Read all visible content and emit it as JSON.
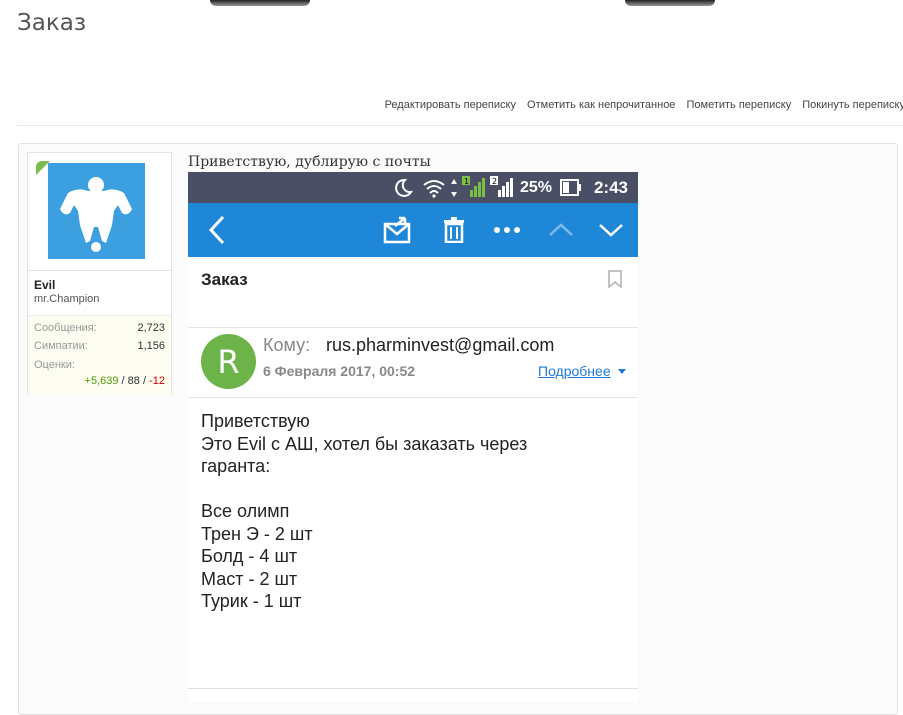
{
  "page": {
    "title": "Заказ"
  },
  "conversation_links": [
    "Редактировать переписку",
    "Отметить как непрочитанное",
    "Пометить переписку",
    "Покинуть переписку"
  ],
  "user": {
    "name": "Evil",
    "title": "mr.Champion",
    "stats": [
      {
        "label": "Сообщения:",
        "value": "2,723"
      },
      {
        "label": "Симпатии:",
        "value": "1,156"
      }
    ],
    "ratings_label": "Оценки:",
    "ratings": {
      "positive": "+5,639",
      "neutral": "88",
      "negative": "-12"
    }
  },
  "message": {
    "intro": "Приветствую, дублирую с почты",
    "phone": {
      "status": {
        "battery": "25%",
        "time": "2:43"
      },
      "subject": "Заказ",
      "sender_initial": "R",
      "to_label": "Кому:",
      "to_email": "rus.pharminvest@gmail.com",
      "date": "6 Февраля 2017, 00:52",
      "more_label": "Подробнее",
      "body_lines": [
        "Приветствую",
        "Это Evil с АШ, хотел бы заказать через",
        "гаранта:",
        "",
        "Все олимп",
        "Трен Э - 2 шт",
        "Болд - 4 шт",
        "Маст - 2 шт",
        "Турик - 1 шт"
      ]
    }
  },
  "colors": {
    "app_bar": "#1e87d8",
    "status_bar": "#4b4f66",
    "sender_avatar": "#6cb34a",
    "user_avatar": "#3ca0e0"
  }
}
